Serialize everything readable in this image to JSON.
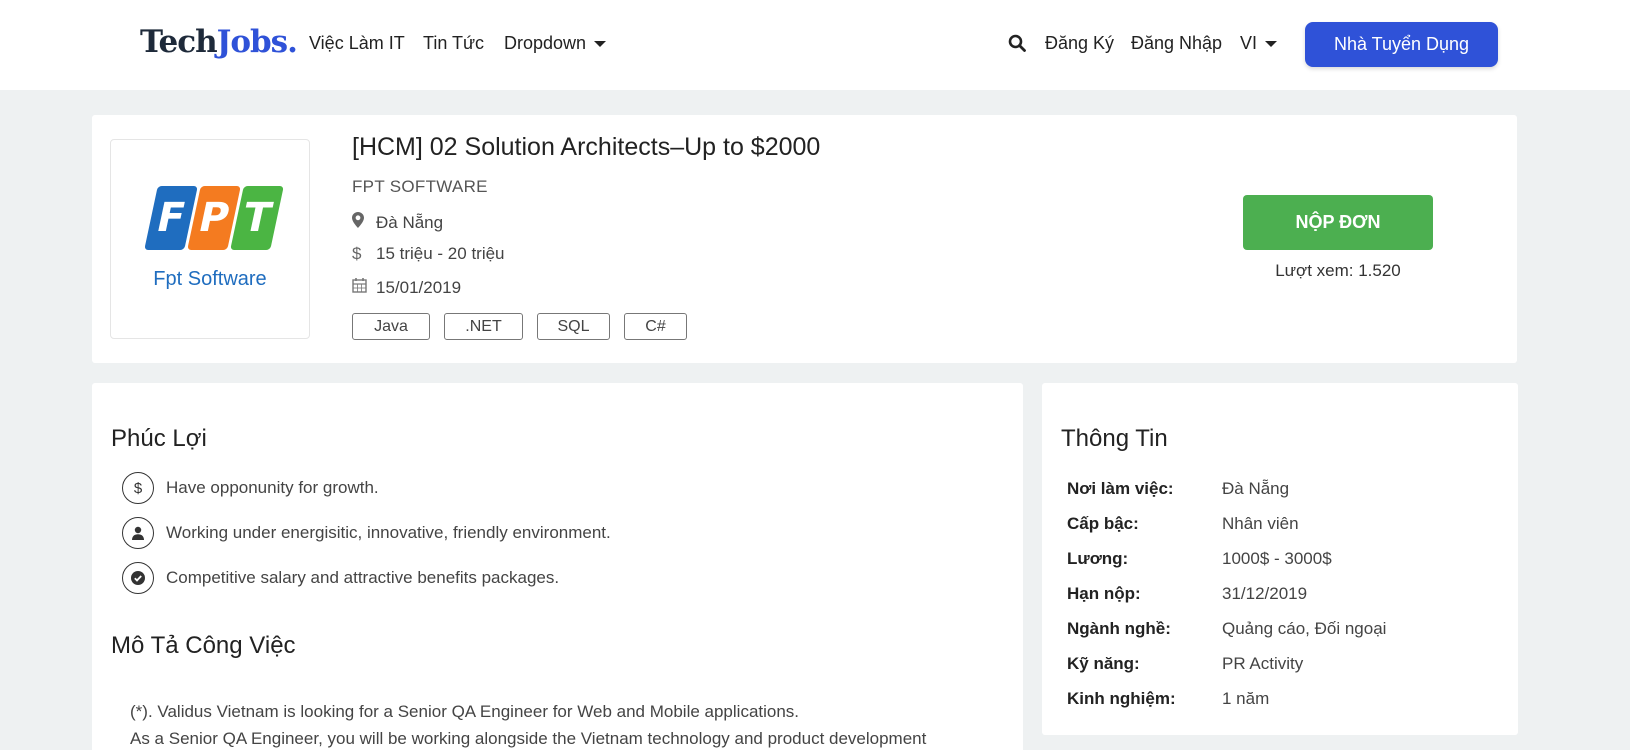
{
  "header": {
    "logo_part1": "Tech",
    "logo_part2": "Jobs.",
    "nav": [
      "Việc Làm IT",
      "Tin Tức",
      "Dropdown"
    ],
    "register": "Đăng Ký",
    "login": "Đăng Nhập",
    "language": "VI",
    "employer_button": "Nhà Tuyển Dụng"
  },
  "job": {
    "logo_letters": [
      "F",
      "P",
      "T"
    ],
    "logo_sub": "Fpt Software",
    "title": "[HCM] 02 Solution Architects–Up to $2000",
    "company": "FPT SOFTWARE",
    "location": "Đà Nẵng",
    "salary": "15 triệu - 20 triệu",
    "date": "15/01/2019",
    "tags": [
      "Java",
      ".NET",
      "SQL",
      "C#"
    ],
    "apply_label": "NỘP ĐƠN",
    "views": "Lượt xem: 1.520"
  },
  "benefits": {
    "title": "Phúc Lợi",
    "items": [
      {
        "icon": "dollar-icon",
        "text": "Have opponunity for growth."
      },
      {
        "icon": "user-icon",
        "text": "Working under energisitic, innovative, friendly environment."
      },
      {
        "icon": "check-icon",
        "text": "Competitive salary and attractive benefits packages."
      }
    ]
  },
  "description": {
    "title": "Mô Tả Công Việc",
    "lines": [
      "(*). Validus Vietnam is looking for a Senior QA Engineer for Web and Mobile applications.",
      "As a Senior QA Engineer, you will be working alongside the Vietnam technology and product development"
    ]
  },
  "info": {
    "title": "Thông Tin",
    "rows": [
      {
        "key": "Nơi làm việc:",
        "value": "Đà Nẵng"
      },
      {
        "key": "Cấp bậc:",
        "value": "Nhân viên"
      },
      {
        "key": "Lương:",
        "value": "1000$ - 3000$"
      },
      {
        "key": "Hạn nộp:",
        "value": "31/12/2019"
      },
      {
        "key": "Ngành nghề:",
        "value": "Quảng cáo, Đối ngoại"
      },
      {
        "key": "Kỹ năng:",
        "value": "PR Activity"
      },
      {
        "key": "Kinh nghiệm:",
        "value": "1 năm"
      }
    ]
  },
  "colors": {
    "primary": "#2f52d8",
    "apply": "#4caf50",
    "fpt_blue": "#1f6dbf",
    "fpt_orange": "#f47b20",
    "fpt_green": "#4bb543"
  }
}
